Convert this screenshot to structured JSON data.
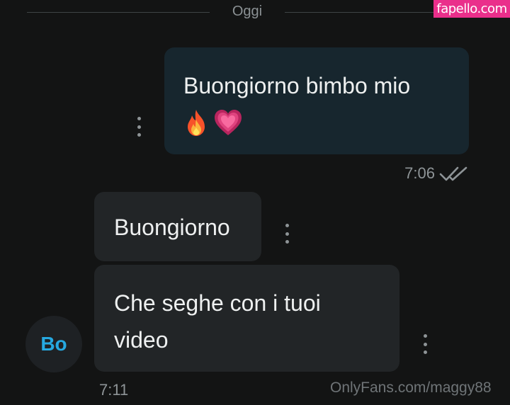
{
  "chat": {
    "date_label": "Oggi",
    "messages": [
      {
        "direction": "outgoing",
        "text": "Buongiorno bimbo mio",
        "emojis": [
          "fire-emoji",
          "beating-heart-emoji"
        ],
        "time": "7:06",
        "status_icon": "double-check-icon"
      },
      {
        "direction": "incoming",
        "text": "Buongiorno"
      },
      {
        "direction": "incoming",
        "text": "Che seghe con i tuoi video",
        "time": "7:11"
      }
    ],
    "avatar_initials": "Bo"
  },
  "watermarks": {
    "top": "fapello.com",
    "bottom": "OnlyFans.com/maggy88"
  },
  "colors": {
    "background": "#131414",
    "outgoing_bubble": "#17262e",
    "incoming_bubble": "#222527",
    "avatar_text": "#26a9e1",
    "watermark_badge": "#ea2f8b"
  }
}
